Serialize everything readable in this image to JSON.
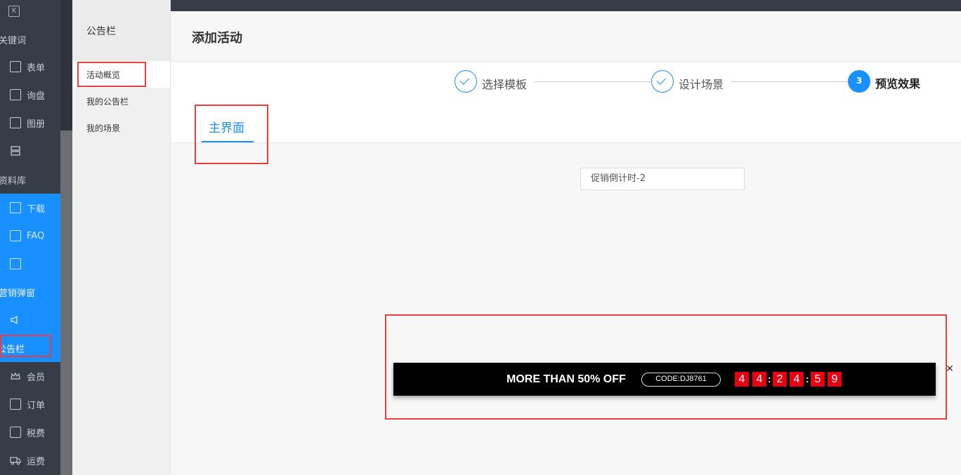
{
  "sidebar": {
    "groups": [
      {
        "label": "关键词"
      },
      {
        "label": "资料库"
      },
      {
        "label": "营销弹窗"
      }
    ],
    "items": [
      {
        "label": "表单",
        "icon": "form-icon"
      },
      {
        "label": "询盘",
        "icon": "inquiry-icon"
      },
      {
        "label": "图册",
        "icon": "album-icon"
      },
      {
        "label": "",
        "icon": "server-icon"
      },
      {
        "label": "下载",
        "icon": "download-icon"
      },
      {
        "label": "FAQ",
        "icon": "faq-icon"
      },
      {
        "label": "",
        "icon": "expand-icon"
      },
      {
        "label": "",
        "icon": "megaphone-icon"
      },
      {
        "label": "公告栏",
        "icon": ""
      },
      {
        "label": "会员",
        "icon": "crown-icon"
      },
      {
        "label": "订单",
        "icon": "order-icon"
      },
      {
        "label": "税费",
        "icon": "tax-icon"
      },
      {
        "label": "运费",
        "icon": "truck-icon"
      }
    ]
  },
  "subnav": {
    "title": "公告栏",
    "items": [
      {
        "label": "活动概览"
      },
      {
        "label": "我的公告栏"
      },
      {
        "label": "我的场景"
      }
    ]
  },
  "page": {
    "title": "添加活动"
  },
  "steps": [
    {
      "label": "选择模板",
      "state": "done"
    },
    {
      "label": "设计场景",
      "state": "done"
    },
    {
      "label": "预览效果",
      "number": "3",
      "state": "current"
    }
  ],
  "tabs": [
    {
      "label": "主界面"
    }
  ],
  "scene_select": {
    "value": "促销倒计时-2"
  },
  "preview": {
    "headline": "MORE THAN 50% OFF",
    "code": "CODE:DJ8761",
    "countdown": [
      "4",
      "4",
      "2",
      "4",
      "5",
      "9"
    ],
    "separator": ":",
    "close": "✕"
  },
  "colors": {
    "accent": "#1890ff",
    "sidebar_dark": "#373d47",
    "digit_red": "#e60012",
    "highlight_red": "#e84040"
  }
}
